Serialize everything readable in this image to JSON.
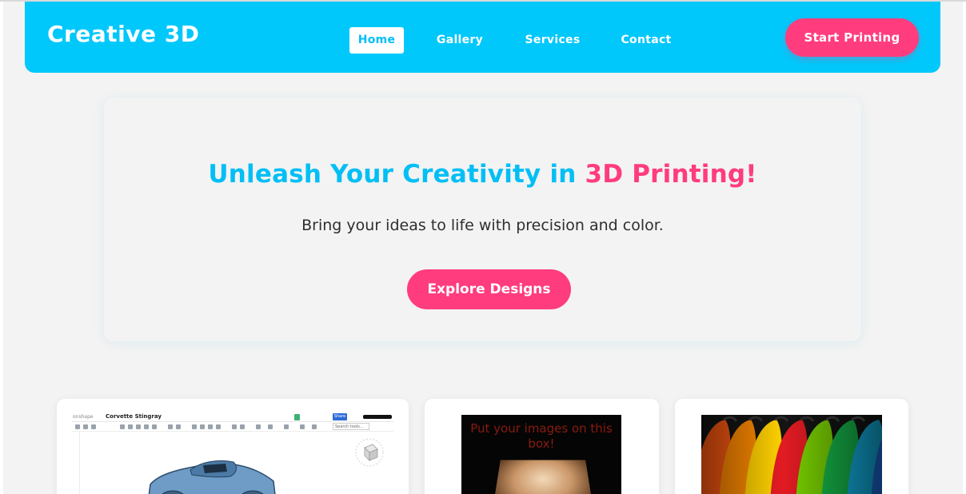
{
  "brand": {
    "name": "Creative 3D"
  },
  "nav": {
    "links": [
      {
        "label": "Home",
        "active": true
      },
      {
        "label": "Gallery",
        "active": false
      },
      {
        "label": "Services",
        "active": false
      },
      {
        "label": "Contact",
        "active": false
      }
    ],
    "cta_label": "Start Printing"
  },
  "hero": {
    "title_main": "Unleash Your Creativity in ",
    "title_accent": "3D Printing!",
    "subtitle": "Bring your ideas to life with precision and color.",
    "button_label": "Explore Designs"
  },
  "cards": [
    {
      "image": "cad-model-screenshot",
      "cad": {
        "logo": "onshape",
        "doc_title": "Corvette Stingray",
        "share_label": "Share",
        "search_placeholder": "Search tools..."
      }
    },
    {
      "image": "lightbox-photo",
      "overlay_text": "Put your images on this box!"
    },
    {
      "image": "filament-spools-photo"
    }
  ],
  "colors": {
    "primary": "#00c8fb",
    "accent": "#ff3c7d",
    "background": "#f3f3f3",
    "text": "#2e2e2e"
  }
}
